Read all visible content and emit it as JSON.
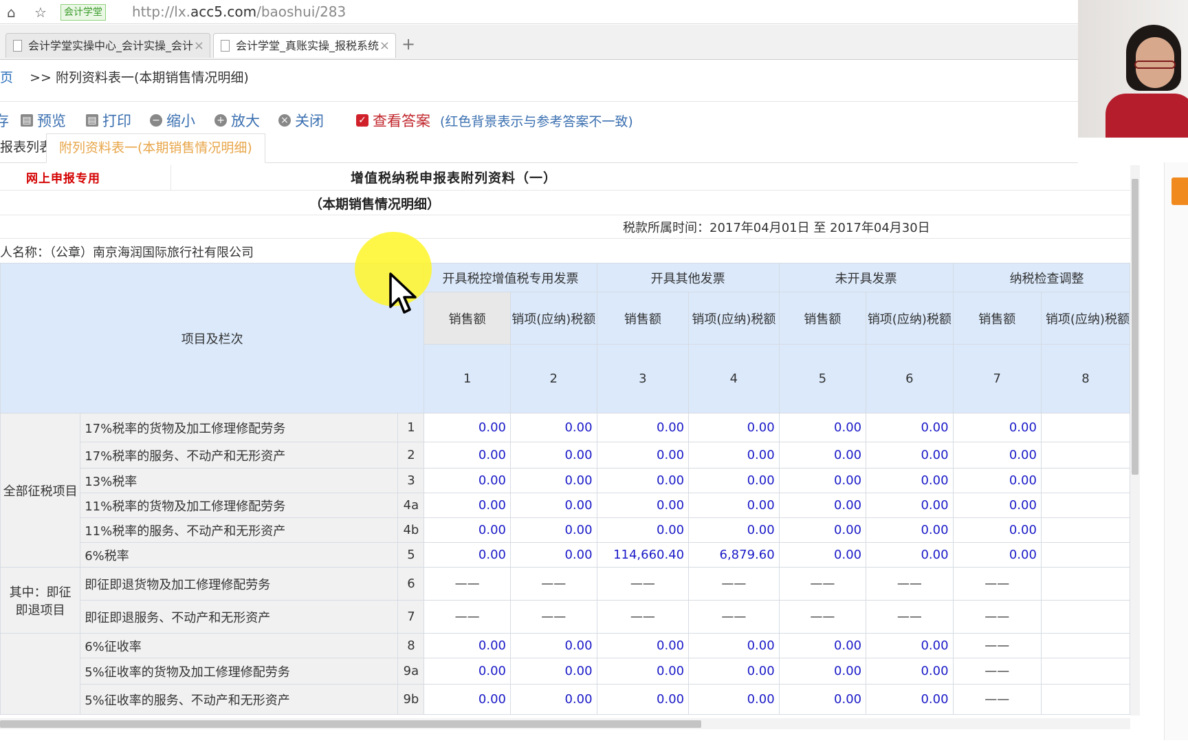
{
  "browser": {
    "site_badge": "会计学堂",
    "url_prefix": "http://lx.",
    "url_host": "acc5.com",
    "url_path": "/baoshui/283",
    "tabs": [
      {
        "label": "会计学堂实操中心_会计实操_会计"
      },
      {
        "label": "会计学堂_真账实操_报税系统"
      }
    ],
    "new_tab": "+"
  },
  "breadcrumb": {
    "home": "页",
    "current": ">> 附列资料表一(本期销售情况明细)"
  },
  "toolbar": {
    "edge": "存",
    "preview": "预览",
    "print": "打印",
    "zoom_out": "缩小",
    "zoom_in": "放大",
    "close": "关闭",
    "view_answer": "查看答案",
    "answer_hint": "(红色背景表示与参考答案不一致)"
  },
  "page_tabs": {
    "list": "报表列表",
    "active": "附列资料表一(本期销售情况明细)"
  },
  "form": {
    "online_only": "网上申报专用",
    "title": "增值税纳税申报表附列资料（一）",
    "subtitle": "（本期销售情况明细）",
    "period": "税款所属时间：2017年04月01日 至 2017年04月30日",
    "taxpayer": "纳税人名称：（公章）南京海润国际旅行社有限公司",
    "item_header": "项目及栏次",
    "groups": [
      "开具税控增值税专用发票",
      "开具其他发票",
      "未开具发票",
      "纳税检查调整"
    ],
    "subheaders": [
      "销售额",
      "销项(应纳)税额",
      "销售额",
      "销项(应纳)税额",
      "销售额",
      "销项(应纳)税额",
      "销售额",
      "销项(应纳)税额"
    ],
    "col_numbers": [
      "1",
      "2",
      "3",
      "4",
      "5",
      "6",
      "7",
      "8"
    ],
    "row_groups": {
      "all": "全部征税项目",
      "refund": "其中：即征即退项目"
    },
    "rows": [
      {
        "label": "17%税率的货物及加工修理修配劳务",
        "line": "1",
        "cells": [
          "0.00",
          "0.00",
          "0.00",
          "0.00",
          "0.00",
          "0.00",
          "0.00"
        ]
      },
      {
        "label": "17%税率的服务、不动产和无形资产",
        "line": "2",
        "cells": [
          "0.00",
          "0.00",
          "0.00",
          "0.00",
          "0.00",
          "0.00",
          "0.00"
        ]
      },
      {
        "label": "13%税率",
        "line": "3",
        "cells": [
          "0.00",
          "0.00",
          "0.00",
          "0.00",
          "0.00",
          "0.00",
          "0.00"
        ]
      },
      {
        "label": "11%税率的货物及加工修理修配劳务",
        "line": "4a",
        "cells": [
          "0.00",
          "0.00",
          "0.00",
          "0.00",
          "0.00",
          "0.00",
          "0.00"
        ]
      },
      {
        "label": "11%税率的服务、不动产和无形资产",
        "line": "4b",
        "cells": [
          "0.00",
          "0.00",
          "0.00",
          "0.00",
          "0.00",
          "0.00",
          "0.00"
        ]
      },
      {
        "label": "6%税率",
        "line": "5",
        "cells": [
          "0.00",
          "0.00",
          "114,660.40",
          "6,879.60",
          "0.00",
          "0.00",
          "0.00"
        ]
      },
      {
        "label": "即征即退货物及加工修理修配劳务",
        "line": "6",
        "cells": [
          "——",
          "——",
          "——",
          "——",
          "——",
          "——",
          "——"
        ]
      },
      {
        "label": "即征即退服务、不动产和无形资产",
        "line": "7",
        "cells": [
          "——",
          "——",
          "——",
          "——",
          "——",
          "——",
          "——"
        ]
      },
      {
        "label": "6%征收率",
        "line": "8",
        "cells": [
          "0.00",
          "0.00",
          "0.00",
          "0.00",
          "0.00",
          "0.00",
          "——"
        ]
      },
      {
        "label": "5%征收率的货物及加工修理修配劳务",
        "line": "9a",
        "cells": [
          "0.00",
          "0.00",
          "0.00",
          "0.00",
          "0.00",
          "0.00",
          "——"
        ]
      },
      {
        "label": "5%征收率的服务、不动产和无形资产",
        "line": "9b",
        "cells": [
          "0.00",
          "0.00",
          "0.00",
          "0.00",
          "0.00",
          "0.00",
          "——"
        ]
      }
    ]
  }
}
